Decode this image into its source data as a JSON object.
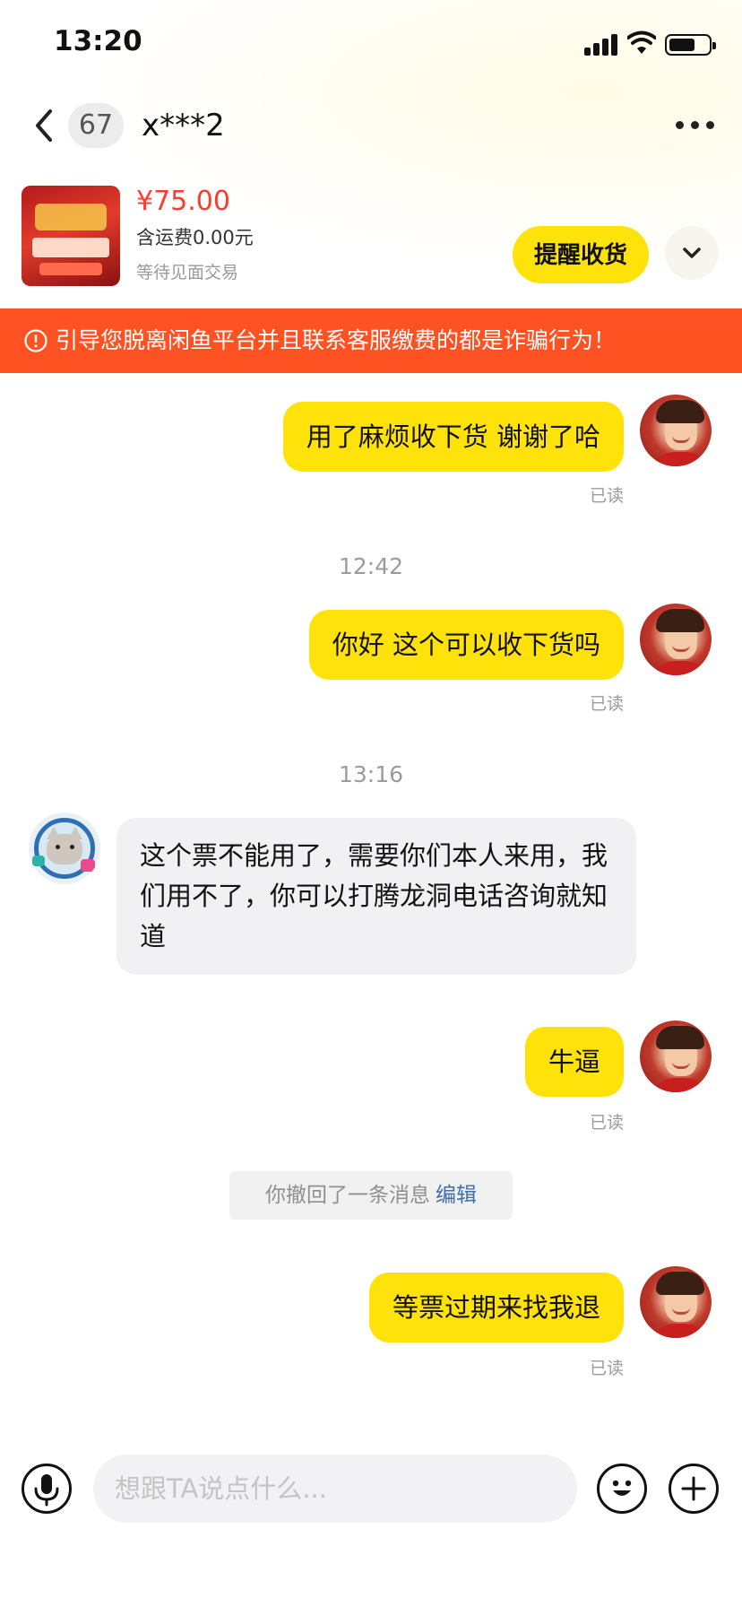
{
  "status_bar": {
    "time": "13:20"
  },
  "nav": {
    "unread_count": "67",
    "title": "x***2"
  },
  "product": {
    "price": "¥75.00",
    "shipping": "含运费0.00元",
    "trade_status": "等待见面交易",
    "remind_button": "提醒收货"
  },
  "warning": {
    "text": "引导您脱离闲鱼平台并且联系客服缴费的都是诈骗行为！"
  },
  "chat": {
    "read_label": "已读",
    "messages": [
      {
        "from": "self",
        "text": "用了麻烦收下货 谢谢了哈"
      },
      {
        "time": "12:42"
      },
      {
        "from": "self",
        "text": "你好 这个可以收下货吗"
      },
      {
        "time": "13:16"
      },
      {
        "from": "other",
        "text": "这个票不能用了，需要你们本人来用，我们用不了，你可以打腾龙洞电话咨询就知道"
      },
      {
        "from": "self",
        "text": "牛逼"
      },
      {
        "recall": "你撤回了一条消息",
        "edit": "编辑"
      },
      {
        "from": "self",
        "text": "等票过期来找我退"
      }
    ]
  },
  "input": {
    "placeholder": "想跟TA说点什么..."
  },
  "icons": {
    "back": "chevron-left-icon",
    "more": "more-horizontal-icon",
    "expand": "chevron-down-icon",
    "warning": "alert-circle-icon",
    "mic": "microphone-icon",
    "emoji": "emoji-icon",
    "plus": "plus-icon"
  },
  "colors": {
    "accent_yellow": "#ffe20a",
    "warning_orange": "#ff5222",
    "price_red": "#ff3b30",
    "edit_blue": "#3f6ea8"
  }
}
